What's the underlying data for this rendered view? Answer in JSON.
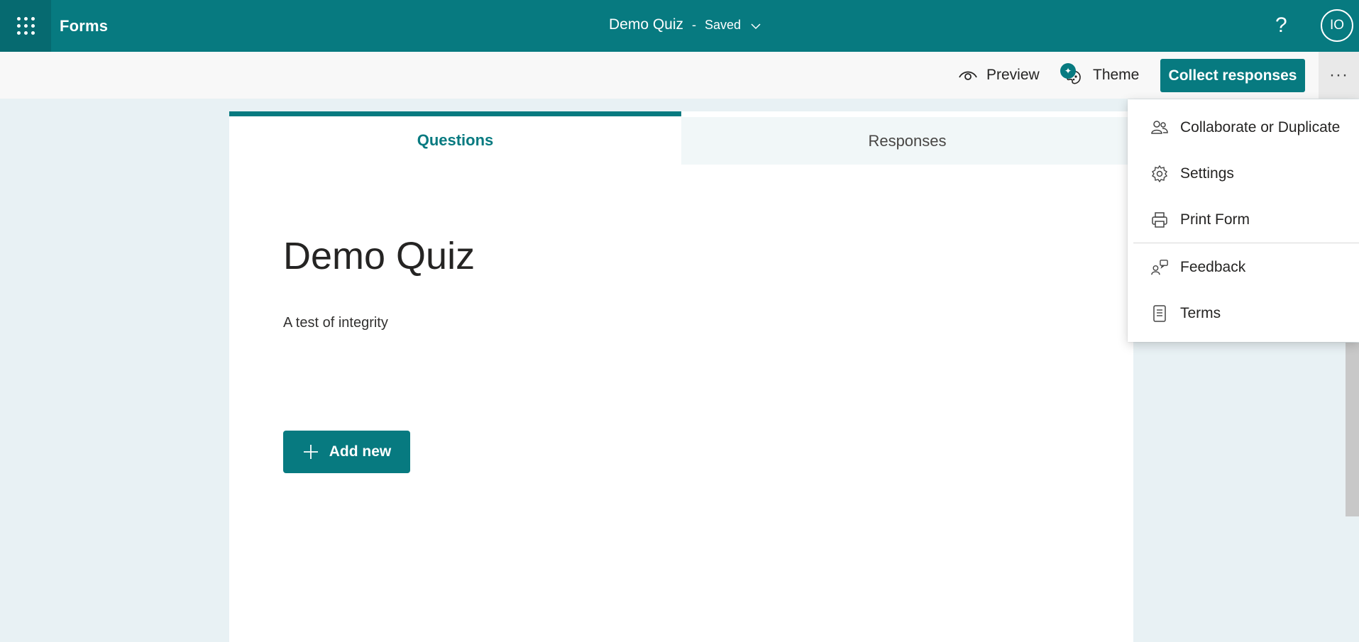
{
  "app": {
    "name": "Forms",
    "waffle_icon": "waffle-icon"
  },
  "header": {
    "form_title": "Demo Quiz",
    "separator": "-",
    "save_status": "Saved",
    "help_label": "?",
    "avatar_initials": "IO"
  },
  "commandbar": {
    "preview_label": "Preview",
    "theme_label": "Theme",
    "collect_label": "Collect responses",
    "more_label": "···"
  },
  "tabs": [
    {
      "label": "Questions",
      "selected": true
    },
    {
      "label": "Responses",
      "selected": false
    }
  ],
  "form": {
    "title": "Demo Quiz",
    "description": "A test of integrity",
    "add_new_label": "Add new"
  },
  "menu": {
    "items": [
      {
        "label": "Collaborate or Duplicate",
        "icon": "people-icon"
      },
      {
        "label": "Settings",
        "icon": "gear-icon"
      },
      {
        "label": "Print Form",
        "icon": "printer-icon"
      },
      {
        "label": "Feedback",
        "icon": "feedback-icon"
      },
      {
        "label": "Terms",
        "icon": "document-icon"
      }
    ]
  },
  "colors": {
    "brand": "#077a80",
    "brand_dark": "#066a70",
    "background": "#e8f1f4"
  }
}
